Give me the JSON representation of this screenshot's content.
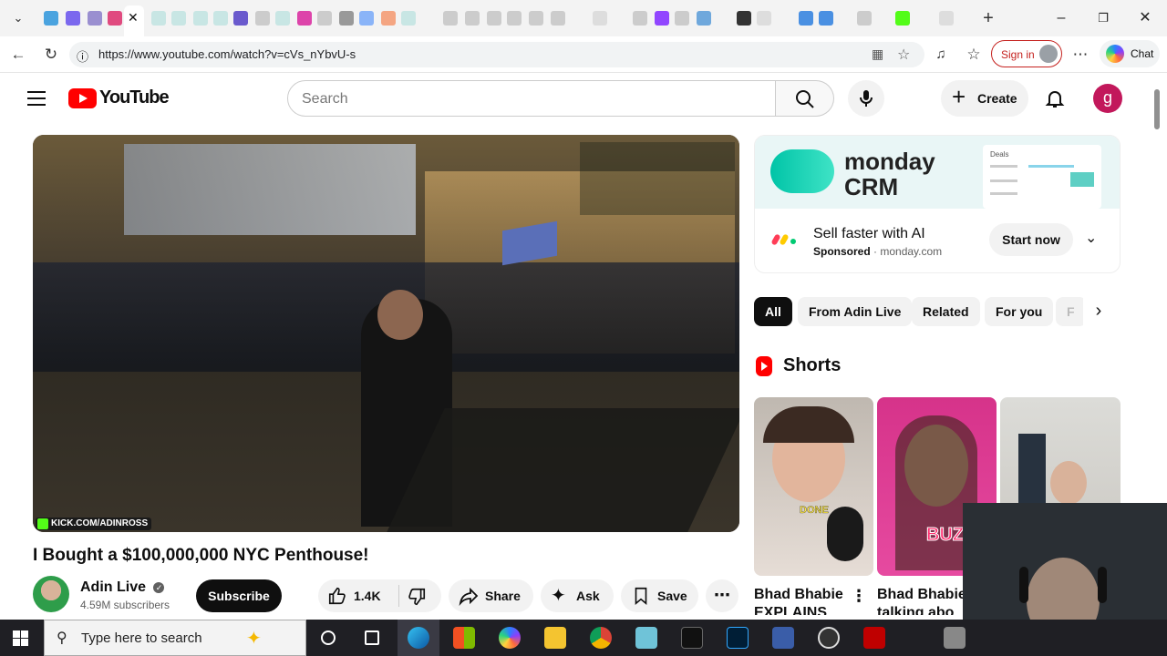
{
  "browser": {
    "url": "https://www.youtube.com/watch?v=cVs_nYbvU-s",
    "signin_label": "Sign in",
    "chat_label": "Chat"
  },
  "youtube": {
    "logo_text": "YouTube",
    "search_placeholder": "Search",
    "create_label": "Create",
    "avatar_letter": "g"
  },
  "video": {
    "overlay_text": "KICK.COM/ADINROSS",
    "title": "I Bought a $100,000,000 NYC Penthouse!",
    "channel": "Adin Live",
    "subscribers": "4.59M subscribers",
    "subscribe_label": "Subscribe",
    "likes": "1.4K",
    "share_label": "Share",
    "ask_label": "Ask",
    "save_label": "Save"
  },
  "ad": {
    "brand": "monday",
    "product": "CRM",
    "preview_label": "Deals",
    "headline": "Sell faster with AI",
    "sponsored": "Sponsored",
    "domain": "monday.com",
    "cta": "Start now"
  },
  "chips": [
    "All",
    "From Adin Live",
    "Related",
    "For you",
    "F"
  ],
  "shorts": {
    "heading": "Shorts",
    "items": [
      {
        "title": "Bhad Bhabie EXPLAINS",
        "caption": "DONE"
      },
      {
        "title": "Bhad Bhabie talking abo",
        "caption": "BUZZ"
      }
    ]
  },
  "taskbar": {
    "search_placeholder": "Type here to search"
  },
  "colors": {
    "youtube_red": "#ff0000",
    "monday_teal": "#00c4a7",
    "taskbar": "#1f1f24",
    "kick_green": "#53fc18"
  }
}
